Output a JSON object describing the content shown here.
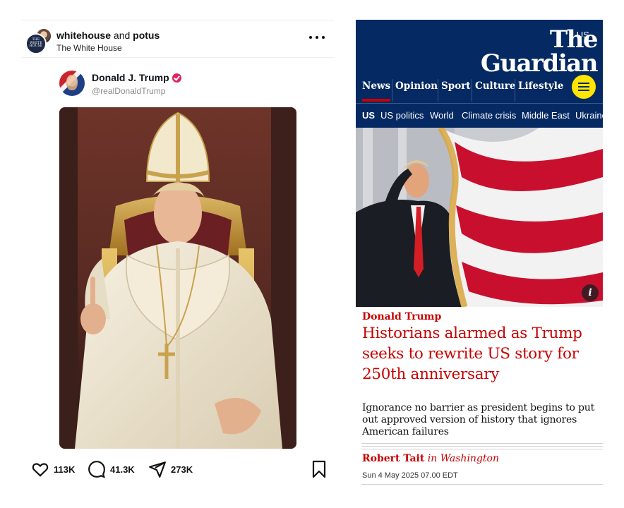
{
  "post": {
    "accounts_primary": "whitehouse",
    "accounts_joiner": " and ",
    "accounts_secondary": "potus",
    "subtitle": "The White House",
    "avatar_badge_text": "THE WHITE HOUSE",
    "tweet": {
      "name": "Donald J. Trump",
      "handle": "@realDonaldTrump"
    },
    "actions": {
      "likes": "113K",
      "comments": "41.3K",
      "shares": "273K"
    }
  },
  "guardian": {
    "edition": "US",
    "logo_line1": "The",
    "logo_line2": "Guardian",
    "nav": [
      {
        "label": "News"
      },
      {
        "label": "Opinion"
      },
      {
        "label": "Sport"
      },
      {
        "label": "Culture"
      },
      {
        "label": "Lifestyle"
      }
    ],
    "subnav": [
      {
        "label": "US"
      },
      {
        "label": "US politics"
      },
      {
        "label": "World"
      },
      {
        "label": "Climate crisis"
      },
      {
        "label": "Middle East"
      },
      {
        "label": "Ukraine"
      }
    ],
    "info_glyph": "i",
    "kicker": "Donald Trump",
    "headline": "Historians alarmed as Trump seeks to rewrite US story for 250th anniversary",
    "standfirst": "Ignorance no barrier as president begins to put out approved version of history that ignores American failures",
    "byline_author": "Robert Tait",
    "byline_location": " in Washington",
    "date": "Sun 4 May 2025 07.00 EDT"
  },
  "colors": {
    "guardian_blue": "#052962",
    "guardian_red": "#c70000",
    "guardian_yellow": "#ffe500",
    "verified_pink": "#e0245e"
  },
  "icons": [
    "more-icon",
    "verified-icon",
    "heart-icon",
    "comment-icon",
    "share-icon",
    "bookmark-icon",
    "chevron-down-icon",
    "menu-icon",
    "info-icon"
  ]
}
